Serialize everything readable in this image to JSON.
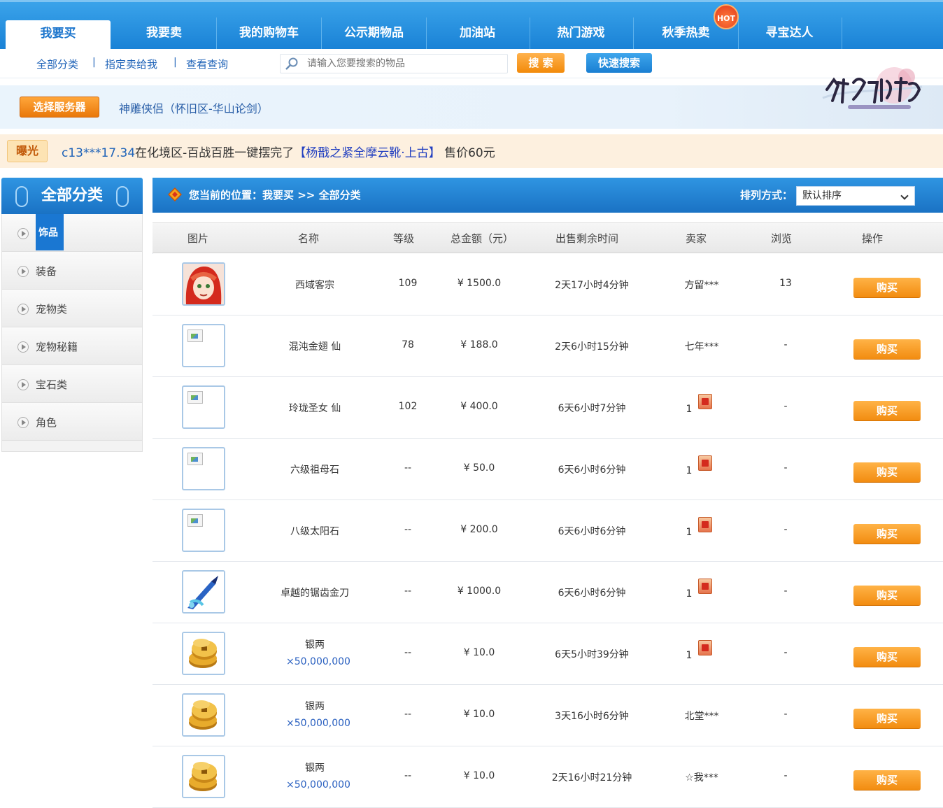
{
  "nav": {
    "tabs": [
      {
        "label": "我要买",
        "active": true
      },
      {
        "label": "我要卖",
        "active": false
      },
      {
        "label": "我的购物车",
        "active": false
      },
      {
        "label": "公示期物品",
        "active": false
      },
      {
        "label": "加油站",
        "active": false
      },
      {
        "label": "热门游戏",
        "active": false
      },
      {
        "label": "秋季热卖",
        "active": false
      },
      {
        "label": "寻宝达人",
        "active": false
      }
    ],
    "hot_badge": "HOT"
  },
  "subnav": {
    "links": [
      "全部分类",
      "指定卖给我",
      "查看查询"
    ],
    "separator": "|",
    "search_placeholder": "请输入您要搜索的物品",
    "search_button": "搜 索",
    "quick_search_button": "快速搜索"
  },
  "server": {
    "button": "选择服务器",
    "name": "神雕侠侣（怀旧区-华山论剑）"
  },
  "banner": {
    "tag": "曝光",
    "user": "c13***17.34",
    "text_mid": "在化境区-百战百胜一键摆完了",
    "item": "【杨戬之紧全摩云靴·上古】",
    "price": "售价60元"
  },
  "sidebar": {
    "title": "全部分类",
    "items": [
      {
        "label": "饰品",
        "active": true
      },
      {
        "label": "装备",
        "active": false
      },
      {
        "label": "宠物类",
        "active": false
      },
      {
        "label": "宠物秘籍",
        "active": false
      },
      {
        "label": "宝石类",
        "active": false
      },
      {
        "label": "角色",
        "active": false
      }
    ]
  },
  "breadcrumb": {
    "text": "您当前的位置：我要买 >> 全部分类",
    "sort_label": "排列方式：",
    "sort_value": "默认排序"
  },
  "table": {
    "headers": [
      "图片",
      "名称",
      "等级",
      "总金额（元）",
      "出售剩余时间",
      "卖家",
      "浏览",
      "操作"
    ],
    "buy_label": "购买",
    "rows": [
      {
        "image": "portrait",
        "name": "西域客宗",
        "qty": "",
        "level": "109",
        "price": "¥ 1500.0",
        "time": "2天17小时4分钟",
        "seller": "方留***",
        "seller_badge": false,
        "views": "13"
      },
      {
        "image": "broken",
        "name": "混沌金翅 仙",
        "qty": "",
        "level": "78",
        "price": "¥ 188.0",
        "time": "2天6小时15分钟",
        "seller": "七年***",
        "seller_badge": false,
        "views": "-"
      },
      {
        "image": "broken",
        "name": "玲珑圣女 仙",
        "qty": "",
        "level": "102",
        "price": "¥ 400.0",
        "time": "6天6小时7分钟",
        "seller": "1",
        "seller_badge": true,
        "views": "-"
      },
      {
        "image": "broken",
        "name": "六级祖母石",
        "qty": "",
        "level": "--",
        "price": "¥ 50.0",
        "time": "6天6小时6分钟",
        "seller": "1",
        "seller_badge": true,
        "views": "-"
      },
      {
        "image": "broken",
        "name": "八级太阳石",
        "qty": "",
        "level": "--",
        "price": "¥ 200.0",
        "time": "6天6小时6分钟",
        "seller": "1",
        "seller_badge": true,
        "views": "-"
      },
      {
        "image": "sword",
        "name": "卓越的锯齿金刀",
        "qty": "",
        "level": "--",
        "price": "¥ 1000.0",
        "time": "6天6小时6分钟",
        "seller": "1",
        "seller_badge": true,
        "views": "-"
      },
      {
        "image": "coins",
        "name": "银两",
        "qty": "×50,000,000",
        "level": "--",
        "price": "¥ 10.0",
        "time": "6天5小时39分钟",
        "seller": "1",
        "seller_badge": true,
        "views": "-"
      },
      {
        "image": "coins",
        "name": "银两",
        "qty": "×50,000,000",
        "level": "--",
        "price": "¥ 10.0",
        "time": "3天16小时6分钟",
        "seller": "北堂***",
        "seller_badge": false,
        "views": "-"
      },
      {
        "image": "coins",
        "name": "银两",
        "qty": "×50,000,000",
        "level": "--",
        "price": "¥ 10.0",
        "time": "2天16小时21分钟",
        "seller": "☆我***",
        "seller_badge": false,
        "views": "-"
      }
    ]
  },
  "colors": {
    "nav_blue": "#1a82d6",
    "button_orange": "#f28c10",
    "link_blue": "#1f63b8",
    "banner_bg": "#fdf0df"
  }
}
